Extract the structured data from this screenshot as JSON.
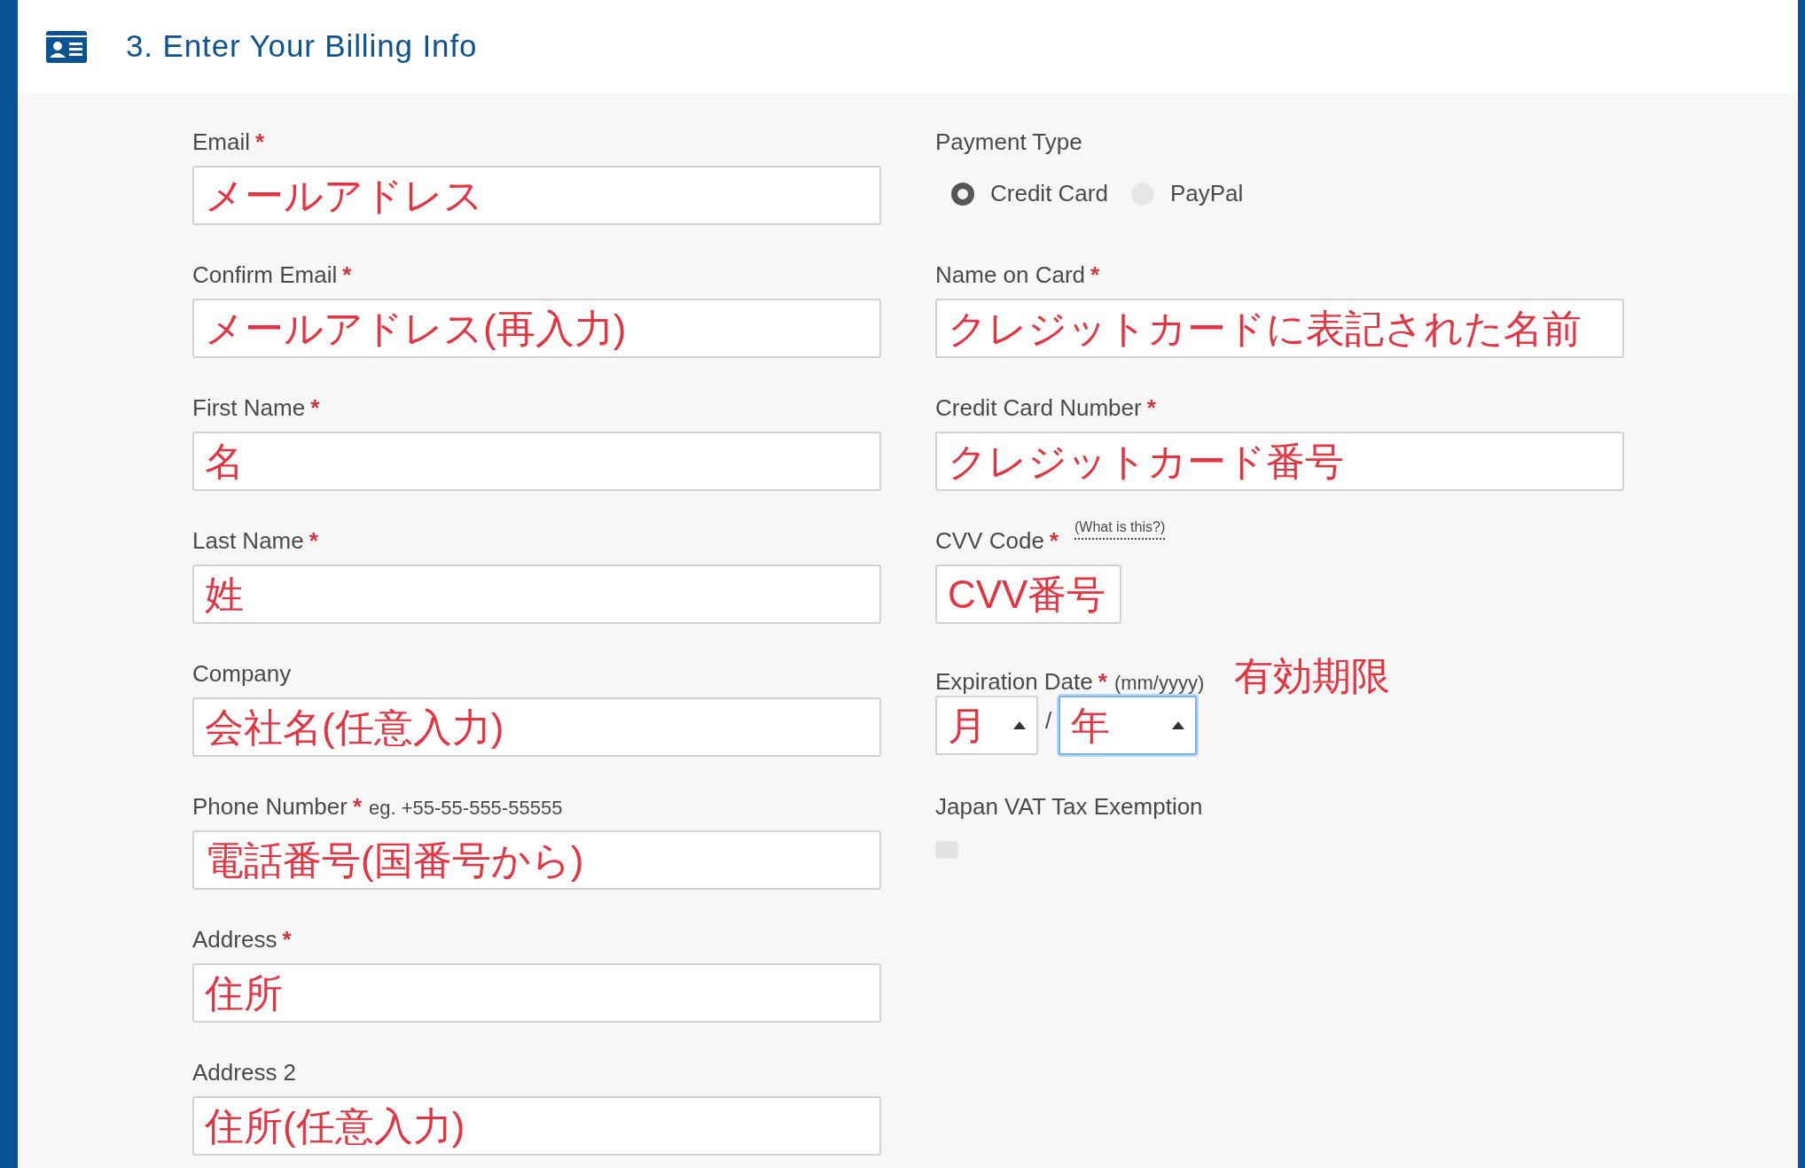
{
  "header": {
    "title": "3. Enter Your Billing Info"
  },
  "left_fields": [
    {
      "label": "Email",
      "required_mark": "*",
      "value": "メールアドレス"
    },
    {
      "label": "Confirm Email",
      "required_mark": "*",
      "value": "メールアドレス(再入力)"
    },
    {
      "label": "First Name",
      "required_mark": "*",
      "value": "名"
    },
    {
      "label": "Last Name",
      "required_mark": "*",
      "value": "姓"
    },
    {
      "label": "Company",
      "value": "会社名(任意入力)"
    },
    {
      "label": "Phone Number",
      "required_mark": "*",
      "hint": "eg. +55-55-555-55555",
      "value": "電話番号(国番号から)"
    },
    {
      "label": "Address",
      "required_mark": "*",
      "value": "住所"
    },
    {
      "label": "Address 2",
      "value": "住所(任意入力)"
    }
  ],
  "payment_type": {
    "label": "Payment Type",
    "options": [
      {
        "label": "Credit Card",
        "selected": true
      },
      {
        "label": "PayPal",
        "selected": false
      }
    ]
  },
  "right_fields": [
    {
      "label": "Name on Card",
      "required_mark": "*",
      "value": "クレジットカードに表記された名前"
    },
    {
      "label": "Credit Card Number",
      "required_mark": "*",
      "value": "クレジットカード番号"
    },
    {
      "label": "CVV Code",
      "required_mark": "*",
      "help_link": "(What is this?)",
      "value": "CVV番号"
    }
  ],
  "expiration": {
    "label": "Expiration Date",
    "required_mark": "*",
    "hint": "(mm/yyyy)",
    "annotation": "有効期限",
    "separator": "/",
    "selects": [
      {
        "value": "月",
        "focused": false
      },
      {
        "value": "年",
        "focused": true
      }
    ]
  },
  "vat": {
    "label": "Japan VAT Tax Exemption",
    "checked": false
  }
}
